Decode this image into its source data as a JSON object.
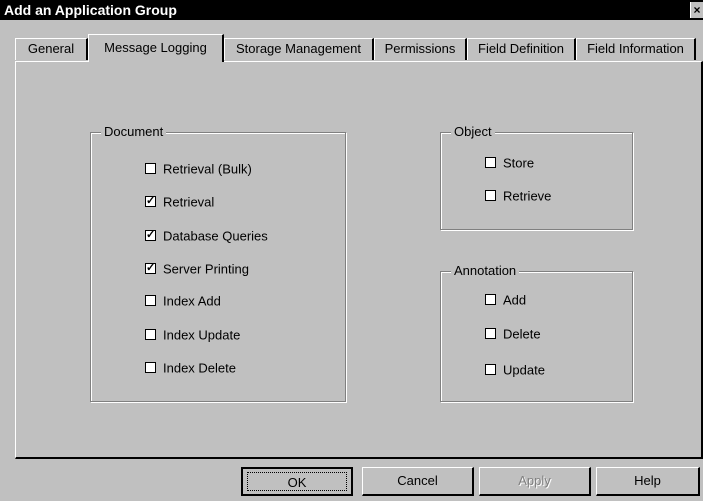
{
  "window": {
    "title": "Add an Application Group",
    "close_glyph": "×"
  },
  "tabs": [
    {
      "label": "General",
      "active": false
    },
    {
      "label": "Message Logging",
      "active": true
    },
    {
      "label": "Storage Management",
      "active": false
    },
    {
      "label": "Permissions",
      "active": false
    },
    {
      "label": "Field Definition",
      "active": false
    },
    {
      "label": "Field Information",
      "active": false
    }
  ],
  "document_group": {
    "title": "Document",
    "items": [
      {
        "label": "Retrieval (Bulk)",
        "checked": false
      },
      {
        "label": "Retrieval",
        "checked": true
      },
      {
        "label": "Database Queries",
        "checked": true
      },
      {
        "label": "Server Printing",
        "checked": true
      },
      {
        "label": "Index Add",
        "checked": false
      },
      {
        "label": "Index Update",
        "checked": false
      },
      {
        "label": "Index Delete",
        "checked": false
      }
    ]
  },
  "object_group": {
    "title": "Object",
    "items": [
      {
        "label": "Store",
        "checked": false
      },
      {
        "label": "Retrieve",
        "checked": false
      }
    ]
  },
  "annotation_group": {
    "title": "Annotation",
    "items": [
      {
        "label": "Add",
        "checked": false
      },
      {
        "label": "Delete",
        "checked": false
      },
      {
        "label": "Update",
        "checked": false
      }
    ]
  },
  "buttons": {
    "ok": "OK",
    "cancel": "Cancel",
    "apply": "Apply",
    "help": "Help"
  },
  "check_glyph": "✓"
}
